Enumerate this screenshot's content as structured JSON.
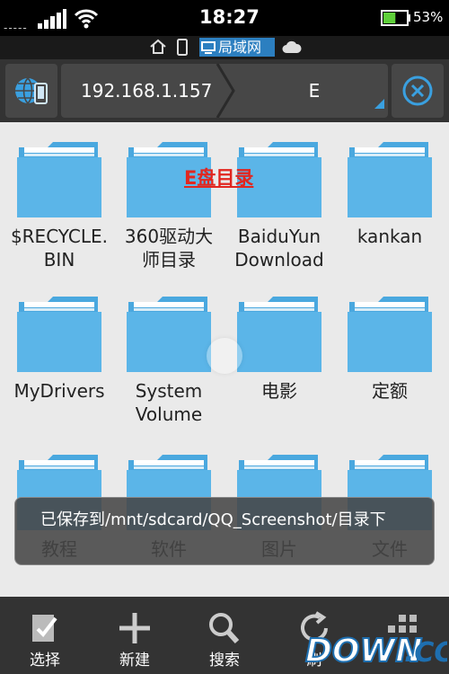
{
  "status_bar": {
    "carrier_dashes": "-----",
    "time": "18:27",
    "battery_pct": "53%",
    "battery_level": 0.53
  },
  "location_bar": {
    "active_label": "局域网"
  },
  "path_bar": {
    "crumbs": [
      "192.168.1.157",
      "E"
    ]
  },
  "overlay_title": "E盘目录",
  "folders": [
    {
      "label": "$RECYCLE.\nBIN"
    },
    {
      "label": "360驱动大\n师目录"
    },
    {
      "label": "BaiduYun\nDownload"
    },
    {
      "label": "kankan"
    },
    {
      "label": "MyDrivers"
    },
    {
      "label": "System\nVolume"
    },
    {
      "label": "电影"
    },
    {
      "label": "定额"
    },
    {
      "label": "教程"
    },
    {
      "label": "软件"
    },
    {
      "label": "图片"
    },
    {
      "label": "文件"
    }
  ],
  "toast": "已保存到/mnt/sdcard/QQ_Screenshot/目录下",
  "toolbar": {
    "items": [
      {
        "label": "选择",
        "icon": "select-icon"
      },
      {
        "label": "新建",
        "icon": "plus-icon"
      },
      {
        "label": "搜索",
        "icon": "search-icon"
      },
      {
        "label": "刷",
        "icon": "refresh-icon"
      }
    ]
  },
  "watermark": "DOWN.CC",
  "colors": {
    "folder_blue": "#5bb5e8",
    "accent_blue": "#2c7fc0",
    "title_red": "#e2261f",
    "bar_dark": "#333333"
  }
}
